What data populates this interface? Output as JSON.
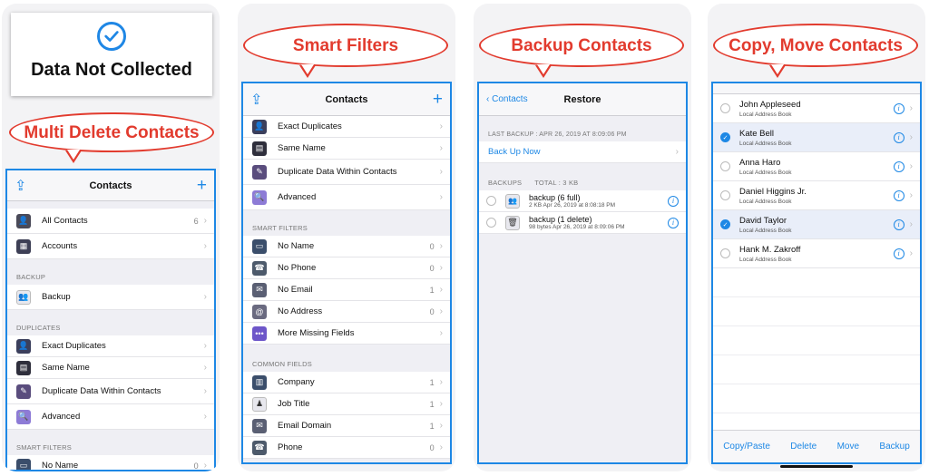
{
  "panel1": {
    "privacy_label": "Data Not Collected",
    "callout": "Multi Delete Contacts",
    "nav_title": "Contacts",
    "share_icon": "share-icon",
    "add_icon": "plus-icon",
    "rows_top": [
      {
        "label": "All Contacts",
        "count": "6",
        "icon": "contacts-icon"
      },
      {
        "label": "Accounts",
        "count": "",
        "icon": "accounts-icon"
      }
    ],
    "section_backup": "BACKUP",
    "backup_row": {
      "label": "Backup",
      "icon": "backup-icon"
    },
    "section_duplicates": "DUPLICATES",
    "dup_rows": [
      {
        "label": "Exact Duplicates",
        "icon": "exact-duplicates-icon"
      },
      {
        "label": "Same Name",
        "icon": "same-name-icon"
      },
      {
        "label": "Duplicate Data Within Contacts",
        "icon": "duplicate-data-icon"
      },
      {
        "label": "Advanced",
        "icon": "advanced-search-icon"
      }
    ],
    "section_smart": "SMART FILTERS",
    "smart_rows": [
      {
        "label": "No Name",
        "count": "0",
        "icon": "no-name-icon"
      }
    ]
  },
  "panel2": {
    "callout": "Smart Filters",
    "nav_title": "Contacts",
    "dup_rows": [
      {
        "label": "Exact Duplicates"
      },
      {
        "label": "Same Name"
      },
      {
        "label": "Duplicate Data Within Contacts"
      },
      {
        "label": "Advanced"
      }
    ],
    "section_smart": "SMART FILTERS",
    "smart_rows": [
      {
        "label": "No Name",
        "count": "0"
      },
      {
        "label": "No Phone",
        "count": "0"
      },
      {
        "label": "No Email",
        "count": "1"
      },
      {
        "label": "No Address",
        "count": "0"
      },
      {
        "label": "More Missing Fields",
        "count": ""
      }
    ],
    "section_common": "COMMON FIELDS",
    "common_rows": [
      {
        "label": "Company",
        "count": "1"
      },
      {
        "label": "Job Title",
        "count": "1"
      },
      {
        "label": "Email Domain",
        "count": "1"
      },
      {
        "label": "Phone",
        "count": "0"
      }
    ]
  },
  "panel3": {
    "callout": "Backup Contacts",
    "back_label": "Contacts",
    "nav_title": "Restore",
    "last_backup": "LAST BACKUP : APR 26, 2019 AT 8:09:06 PM",
    "backup_now": "Back Up Now",
    "section_backups": "BACKUPS",
    "total": "TOTAL : 3 KB",
    "backups": [
      {
        "title": "backup (6 full)",
        "sub": "2 KB  Apr 26, 2019 at 8:08:18 PM",
        "icon": "full-backup-icon"
      },
      {
        "title": "backup (1 delete)",
        "sub": "98 bytes  Apr 26, 2019 at 8:09:06 PM",
        "icon": "trash-icon"
      }
    ]
  },
  "panel4": {
    "callout": "Copy, Move Contacts",
    "contacts": [
      {
        "name": "John Appleseed",
        "sub": "Local Address Book",
        "selected": false
      },
      {
        "name": "Kate Bell",
        "sub": "Local Address Book",
        "selected": true
      },
      {
        "name": "Anna Haro",
        "sub": "Local Address Book",
        "selected": false
      },
      {
        "name": "Daniel Higgins Jr.",
        "sub": "Local Address Book",
        "selected": false
      },
      {
        "name": "David Taylor",
        "sub": "Local Address Book",
        "selected": true
      },
      {
        "name": "Hank M. Zakroff",
        "sub": "Local Address Book",
        "selected": false
      }
    ],
    "toolbar": [
      "Copy/Paste",
      "Delete",
      "Move",
      "Backup"
    ]
  },
  "colors": {
    "accent": "#1e88e5",
    "callout": "#e23b2e"
  }
}
